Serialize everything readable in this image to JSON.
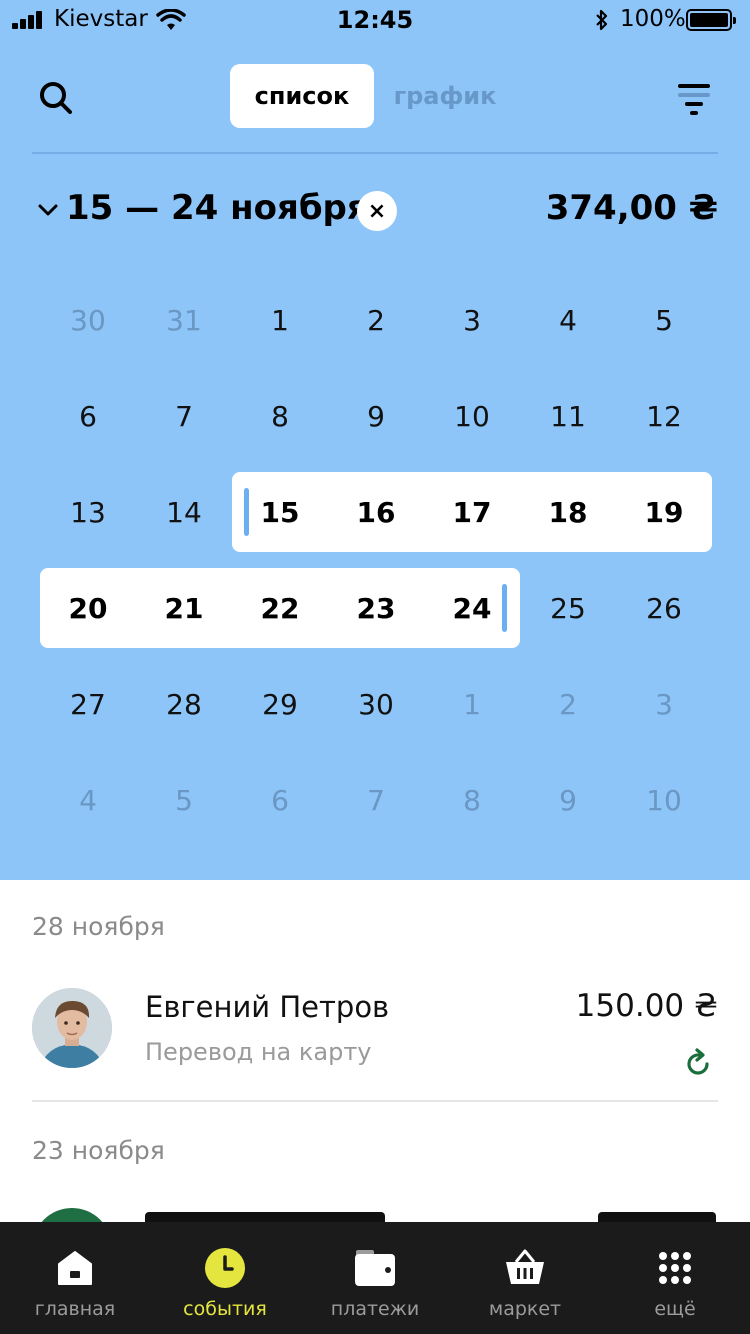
{
  "status_bar": {
    "carrier": "Kievstar",
    "time": "12:45",
    "battery": "100%"
  },
  "header": {
    "segments": [
      "список",
      "график"
    ],
    "active_segment": "список"
  },
  "range": {
    "title": "15 — 24 ноября",
    "clear_label": "×",
    "total": "374,00 ₴"
  },
  "calendar": {
    "weeks": [
      [
        {
          "d": "30",
          "m": true
        },
        {
          "d": "31",
          "m": true
        },
        {
          "d": "1"
        },
        {
          "d": "2"
        },
        {
          "d": "3"
        },
        {
          "d": "4"
        },
        {
          "d": "5"
        }
      ],
      [
        {
          "d": "6"
        },
        {
          "d": "7"
        },
        {
          "d": "8"
        },
        {
          "d": "9"
        },
        {
          "d": "10"
        },
        {
          "d": "11"
        },
        {
          "d": "12"
        }
      ],
      [
        {
          "d": "13"
        },
        {
          "d": "14"
        },
        {
          "d": "15",
          "s": true
        },
        {
          "d": "16",
          "s": true
        },
        {
          "d": "17",
          "s": true
        },
        {
          "d": "18",
          "s": true
        },
        {
          "d": "19",
          "s": true
        }
      ],
      [
        {
          "d": "20",
          "s": true
        },
        {
          "d": "21",
          "s": true
        },
        {
          "d": "22",
          "s": true
        },
        {
          "d": "23",
          "s": true
        },
        {
          "d": "24",
          "s": true
        },
        {
          "d": "25"
        },
        {
          "d": "26"
        }
      ],
      [
        {
          "d": "27"
        },
        {
          "d": "28"
        },
        {
          "d": "29"
        },
        {
          "d": "30"
        },
        {
          "d": "1",
          "m": true
        },
        {
          "d": "2",
          "m": true
        },
        {
          "d": "3",
          "m": true
        }
      ],
      [
        {
          "d": "4",
          "m": true
        },
        {
          "d": "5",
          "m": true
        },
        {
          "d": "6",
          "m": true
        },
        {
          "d": "7",
          "m": true
        },
        {
          "d": "8",
          "m": true
        },
        {
          "d": "9",
          "m": true
        },
        {
          "d": "10",
          "m": true
        }
      ]
    ]
  },
  "sections": [
    {
      "date": "28 ноября",
      "transactions": [
        {
          "name": "Евгений Петров",
          "description": "Перевод на карту",
          "amount": "150.00 ₴",
          "status_icon": "repeat-icon"
        }
      ]
    },
    {
      "date": "23 ноября"
    }
  ],
  "tabbar": {
    "tabs": [
      {
        "label": "главная",
        "icon": "home-icon"
      },
      {
        "label": "события",
        "icon": "clock-icon"
      },
      {
        "label": "платежи",
        "icon": "wallet-icon"
      },
      {
        "label": "маркет",
        "icon": "basket-icon"
      },
      {
        "label": "ещё",
        "icon": "grid-dots-icon"
      }
    ],
    "active_index": 1
  },
  "colors": {
    "header_bg": "#8dc5f9",
    "accent_yellow": "#e5e53f",
    "selection_marker": "#6aaff0",
    "tabbar_bg": "#1b1b1b"
  }
}
